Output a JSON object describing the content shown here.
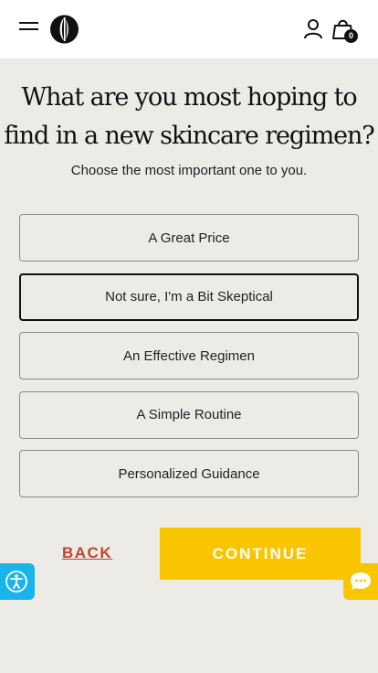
{
  "header": {
    "menu_icon": "hamburger-menu-icon",
    "logo_icon": "brand-logo-icon",
    "account_icon": "user-icon",
    "cart_icon": "shopping-bag-icon",
    "cart_count": "0"
  },
  "quiz": {
    "question_line1": "What are you most hoping to",
    "question_line2": "find in a new skincare regimen?",
    "subtitle": "Choose the most important one to you.",
    "options": [
      {
        "label": "A Great Price",
        "selected": false
      },
      {
        "label": "Not sure, I'm a Bit Skeptical",
        "selected": true
      },
      {
        "label": "An Effective Regimen",
        "selected": false
      },
      {
        "label": "A Simple Routine",
        "selected": false
      },
      {
        "label": "Personalized Guidance",
        "selected": false
      }
    ]
  },
  "actions": {
    "back_label": "BACK",
    "continue_label": "CONTINUE"
  },
  "widgets": {
    "accessibility_icon": "accessibility-icon",
    "chat_icon": "chat-bubble-icon"
  },
  "colors": {
    "background": "#ecebe6",
    "accent_yellow": "#f8c500",
    "back_red": "#c0442e",
    "accessibility_blue": "#19b4ec"
  }
}
